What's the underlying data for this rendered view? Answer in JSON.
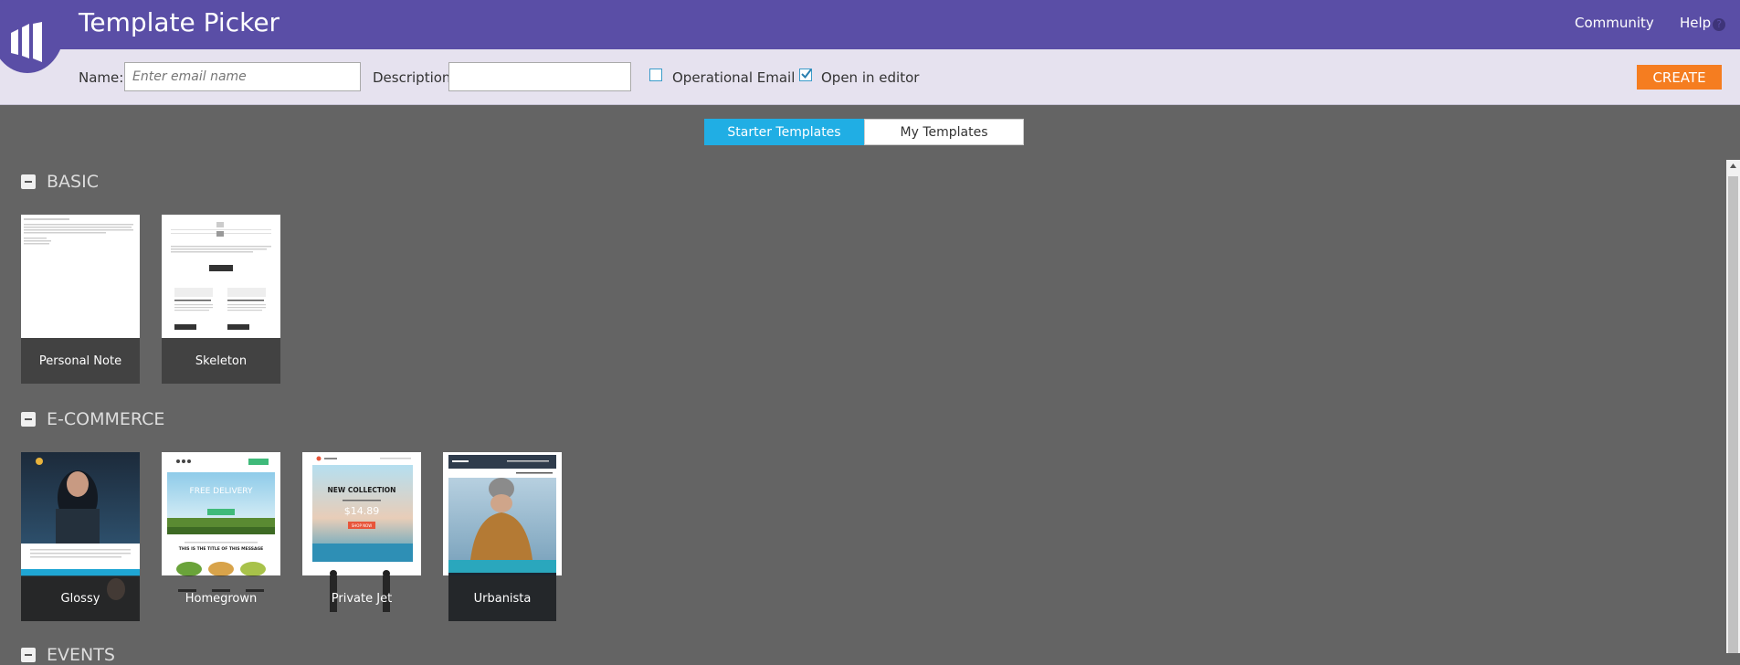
{
  "header": {
    "title": "Template Picker",
    "community_label": "Community",
    "help_label": "Help",
    "help_icon": "?"
  },
  "form": {
    "name_label": "Name:",
    "name_placeholder": "Enter email name",
    "name_value": "",
    "description_label": "Description:",
    "description_value": "",
    "operational_email_label": "Operational Email",
    "operational_email_checked": false,
    "open_in_editor_label": "Open in editor",
    "open_in_editor_checked": true,
    "create_label": "CREATE"
  },
  "tabs": [
    {
      "label": "Starter Templates",
      "active": true
    },
    {
      "label": "My Templates",
      "active": false
    }
  ],
  "sections": [
    {
      "title": "BASIC",
      "templates": [
        {
          "name": "Personal Note"
        },
        {
          "name": "Skeleton"
        }
      ]
    },
    {
      "title": "E-COMMERCE",
      "templates": [
        {
          "name": "Glossy"
        },
        {
          "name": "Homegrown"
        },
        {
          "name": "Private Jet"
        },
        {
          "name": "Urbanista"
        }
      ]
    },
    {
      "title": "EVENTS",
      "templates": []
    }
  ],
  "thumbnails": {
    "homegrown_headline": "FREE DELIVERY",
    "homegrown_subtitle": "THIS IS THE TITLE OF THIS MESSAGE",
    "private_jet_headline": "NEW COLLECTION",
    "private_jet_price": "$14.89",
    "private_jet_button": "SHOP NOW"
  },
  "colors": {
    "header": "#5a4ea6",
    "form_bar": "#e6e2ef",
    "canvas": "#646464",
    "tab_active": "#20aee4",
    "create_button": "#f57d20",
    "checkbox": "#3a9bc9"
  },
  "icons": [
    "logo-icon",
    "help-icon",
    "checkbox-icon",
    "collapse-icon"
  ]
}
